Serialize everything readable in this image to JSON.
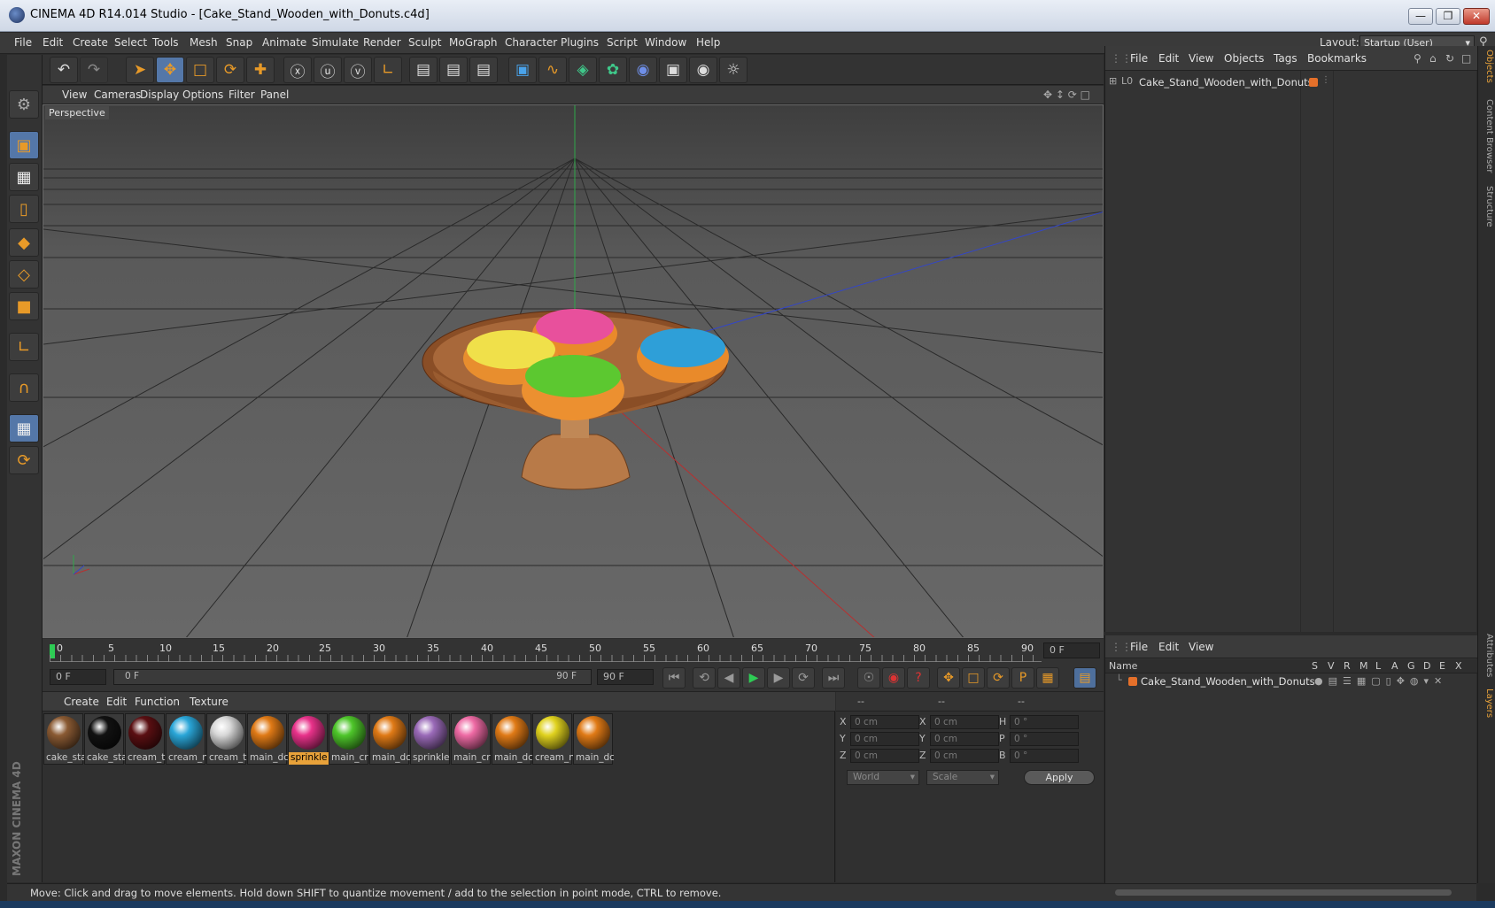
{
  "window": {
    "title": "CINEMA 4D R14.014 Studio - [Cake_Stand_Wooden_with_Donuts.c4d]"
  },
  "menubar": {
    "items": [
      "File",
      "Edit",
      "Create",
      "Select",
      "Tools",
      "Mesh",
      "Snap",
      "Animate",
      "Simulate",
      "Render",
      "Sculpt",
      "MoGraph",
      "Character",
      "Plugins",
      "Script",
      "Window",
      "Help"
    ],
    "layout_label": "Layout:",
    "layout_value": "Startup (User)"
  },
  "viewport": {
    "menu": [
      "View",
      "Cameras",
      "Display",
      "Options",
      "Filter",
      "Panel"
    ],
    "label": "Perspective"
  },
  "timeline": {
    "ticks": [
      "0",
      "5",
      "10",
      "15",
      "20",
      "25",
      "30",
      "35",
      "40",
      "45",
      "50",
      "55",
      "60",
      "65",
      "70",
      "75",
      "80",
      "85",
      "90"
    ],
    "current_frame": "0 F",
    "start_field": "0 F",
    "range_start": "0 F",
    "range_end": "90 F",
    "end_field": "90 F"
  },
  "materials": {
    "menu": [
      "Create",
      "Edit",
      "Function",
      "Texture"
    ],
    "items": [
      {
        "label": "cake_sta",
        "color": "#8a5a33"
      },
      {
        "label": "cake_sta",
        "color": "#111111"
      },
      {
        "label": "cream_t",
        "color": "#5a0f12"
      },
      {
        "label": "cream_n",
        "color": "#2aa6d8"
      },
      {
        "label": "cream_t",
        "color": "#d8d8d8"
      },
      {
        "label": "main_dc",
        "color": "#e07a16"
      },
      {
        "label": "sprinkle",
        "color": "#e8328a"
      },
      {
        "label": "main_cr",
        "color": "#4ec62a"
      },
      {
        "label": "main_dc",
        "color": "#e07a16"
      },
      {
        "label": "sprinkle",
        "color": "#9a6ab8"
      },
      {
        "label": "main_cr",
        "color": "#ee6aa4"
      },
      {
        "label": "main_dc",
        "color": "#e07a16"
      },
      {
        "label": "cream_n",
        "color": "#e0d21e"
      },
      {
        "label": "main_dc",
        "color": "#e07a16"
      }
    ],
    "selected_index": 6
  },
  "coordinates": {
    "headers": [
      "--",
      "--",
      "--"
    ],
    "rows": [
      {
        "a": "X",
        "v1": "0 cm",
        "b": "X",
        "v2": "0 cm",
        "c": "H",
        "v3": "0 °"
      },
      {
        "a": "Y",
        "v1": "0 cm",
        "b": "Y",
        "v2": "0 cm",
        "c": "P",
        "v3": "0 °"
      },
      {
        "a": "Z",
        "v1": "0 cm",
        "b": "Z",
        "v2": "0 cm",
        "c": "B",
        "v3": "0 °"
      }
    ],
    "mode1": "World",
    "mode2": "Scale",
    "apply": "Apply"
  },
  "objects": {
    "menu": [
      "File",
      "Edit",
      "View",
      "Objects",
      "Tags",
      "Bookmarks"
    ],
    "root": "Cake_Stand_Wooden_with_Donuts"
  },
  "layers": {
    "menu": [
      "File",
      "Edit",
      "View"
    ],
    "columns": [
      "Name",
      "S",
      "V",
      "R",
      "M",
      "L",
      "A",
      "G",
      "D",
      "E",
      "X"
    ],
    "row": "Cake_Stand_Wooden_with_Donuts"
  },
  "right_tabs": [
    "Objects",
    "Content Browser",
    "Structure",
    "Attributes",
    "Layers"
  ],
  "status": "Move: Click and drag to move elements. Hold down SHIFT to quantize movement / add to the selection in point mode, CTRL to remove.",
  "logo": "MAXON CINEMA 4D"
}
